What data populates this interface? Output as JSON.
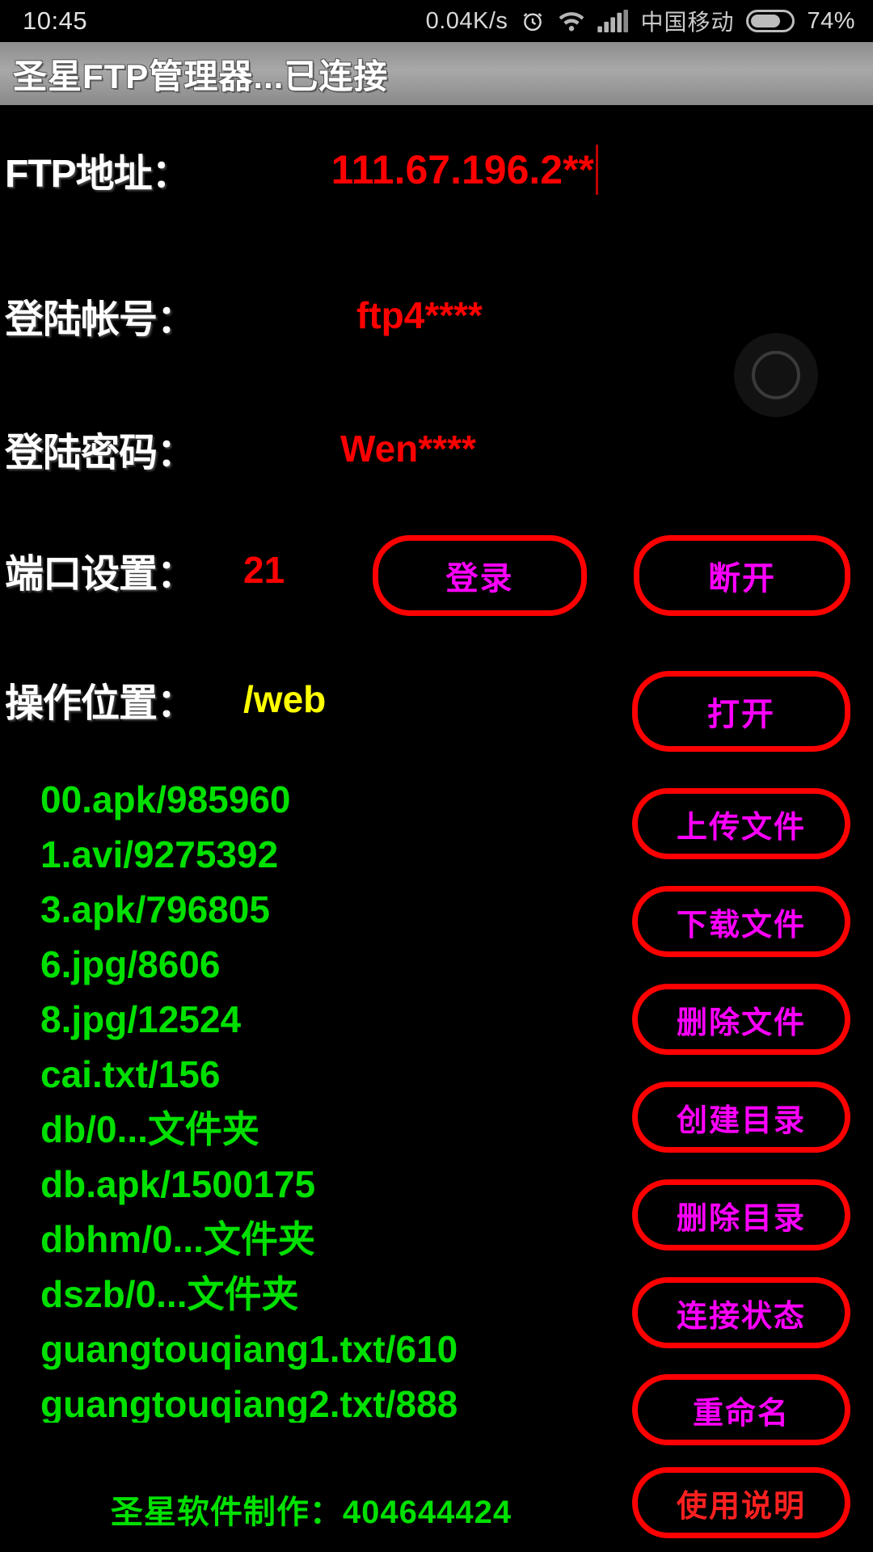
{
  "statusbar": {
    "time": "10:45",
    "net_speed": "0.04K/s",
    "alarm_icon": "alarm-clock-icon",
    "wifi_icon": "wifi-icon",
    "signal_icon": "cellular-signal-icon",
    "carrier": "中国移动",
    "battery_icon": "battery-icon",
    "battery_percent": "74%",
    "battery_level": 74
  },
  "titlebar": {
    "title": "圣星FTP管理器...已连接"
  },
  "form": {
    "address": {
      "label": "FTP地址：",
      "value": "111.67.196.2**"
    },
    "account": {
      "label": "登陆帐号：",
      "value": "ftp4****"
    },
    "password": {
      "label": "登陆密码：",
      "value": "Wen****"
    },
    "port": {
      "label": "端口设置：",
      "value": "21"
    },
    "location": {
      "label": "操作位置：",
      "value": "/web"
    }
  },
  "buttons": {
    "login": "登录",
    "disconnect": "断开",
    "open": "打开",
    "upload": "上传文件",
    "download": "下载文件",
    "delete_file": "删除文件",
    "make_dir": "创建目录",
    "remove_dir": "删除目录",
    "conn_status": "连接状态",
    "rename": "重命名",
    "help": "使用说明"
  },
  "filelist": [
    "00.apk/985960",
    "1.avi/9275392",
    "3.apk/796805",
    "6.jpg/8606",
    "8.jpg/12524",
    "cai.txt/156",
    "db/0...文件夹",
    "db.apk/1500175",
    "dbhm/0...文件夹",
    "dszb/0...文件夹",
    "guangtouqiang1.txt/610",
    "guangtouqiang2.txt/888"
  ],
  "footer": {
    "credit": "圣星软件制作：404644424"
  },
  "colors": {
    "accent_red": "#ff0000",
    "button_text": "#ff00ff",
    "list_green": "#00e000",
    "value_red": "#ff0000",
    "value_yellow": "#ffff00",
    "titlebar_gray": "#a8a8a8"
  },
  "float_button": {
    "icon": "assistive-touch-icon"
  }
}
